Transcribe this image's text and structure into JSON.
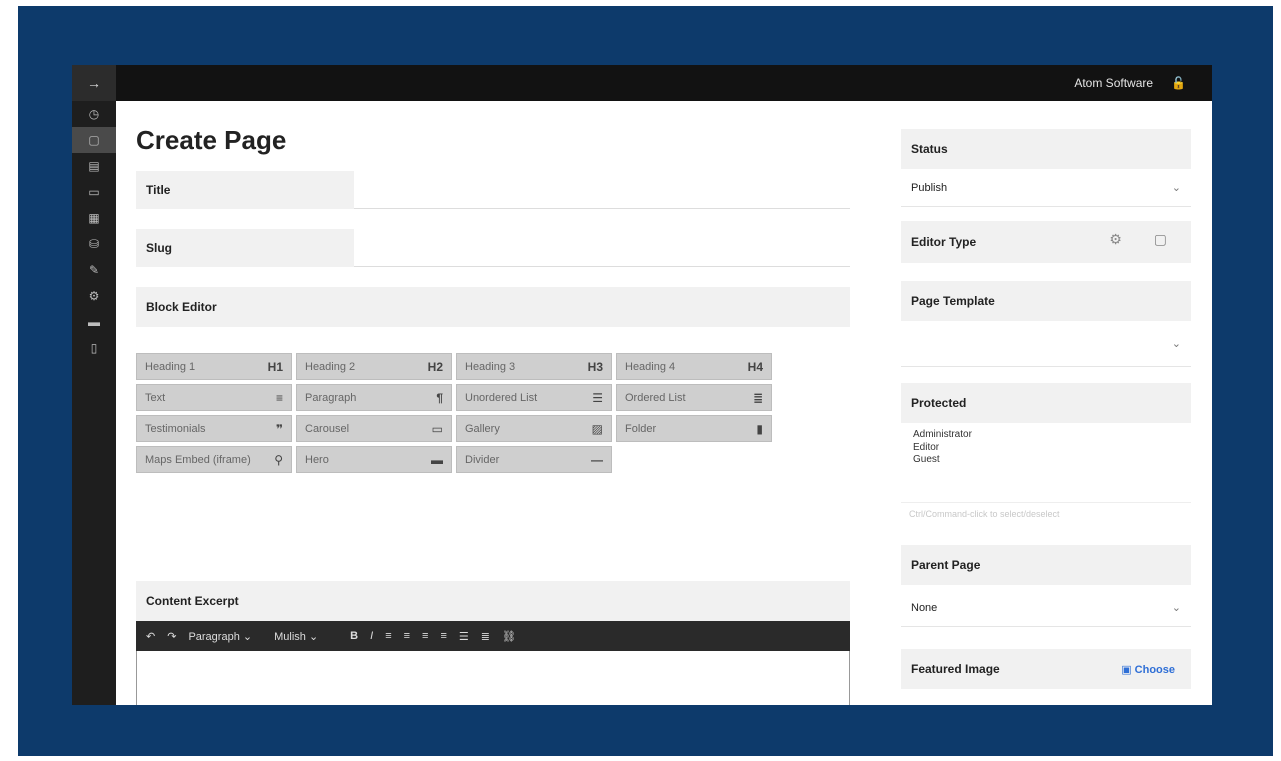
{
  "app": {
    "user_name": "Atom Software"
  },
  "rail": {
    "top_icon": "arrow-right-icon",
    "icons": [
      "dashboard-icon",
      "pages-icon",
      "posts-icon",
      "folder-icon",
      "media-icon",
      "database-icon",
      "brush-icon",
      "settings-icon",
      "inbox-icon",
      "file-icon"
    ]
  },
  "main": {
    "page_title": "Create Page",
    "title_label": "Title",
    "title_value": "",
    "slug_label": "Slug",
    "slug_value": "",
    "block_editor_label": "Block Editor",
    "blocks": [
      [
        {
          "label": "Heading 1",
          "icon": "H1"
        },
        {
          "label": "Heading 2",
          "icon": "H2"
        },
        {
          "label": "Heading 3",
          "icon": "H3"
        },
        {
          "label": "Heading 4",
          "icon": "H4"
        }
      ],
      [
        {
          "label": "Text",
          "icon": "≡"
        },
        {
          "label": "Paragraph",
          "icon": "¶"
        },
        {
          "label": "Unordered List",
          "icon": "☰"
        },
        {
          "label": "Ordered List",
          "icon": "≣"
        }
      ],
      [
        {
          "label": "Testimonials",
          "icon": "❞"
        },
        {
          "label": "Carousel",
          "icon": "▭"
        },
        {
          "label": "Gallery",
          "icon": "▨"
        },
        {
          "label": "Folder",
          "icon": "▮"
        }
      ],
      [
        {
          "label": "Maps Embed (iframe)",
          "icon": "⚲"
        },
        {
          "label": "Hero",
          "icon": "▬"
        },
        {
          "label": "Divider",
          "icon": "—"
        }
      ]
    ],
    "content_excerpt_label": "Content Excerpt",
    "toolbar": {
      "undo": "↶",
      "redo": "↷",
      "paragraph": "Paragraph",
      "paragraph_chevron": "⌄",
      "font": "Mulish",
      "font_chevron": "⌄",
      "bold": "B",
      "italic": "I",
      "align_left": "≡",
      "align_center": "≡",
      "align_right": "≡",
      "align_justify": "≡",
      "bullet_list": "☰",
      "numbered_list": "≣",
      "link": "⛓"
    }
  },
  "side": {
    "status_label": "Status",
    "status_value": "Publish",
    "editor_type_label": "Editor Type",
    "page_template_label": "Page Template",
    "page_template_value": "",
    "protected_label": "Protected",
    "protected_options": [
      "Administrator",
      "Editor",
      "Guest"
    ],
    "protected_hint": "Ctrl/Command-click to select/deselect",
    "parent_page_label": "Parent Page",
    "parent_page_value": "None",
    "featured_image_label": "Featured Image",
    "featured_image_action": "Choose"
  }
}
